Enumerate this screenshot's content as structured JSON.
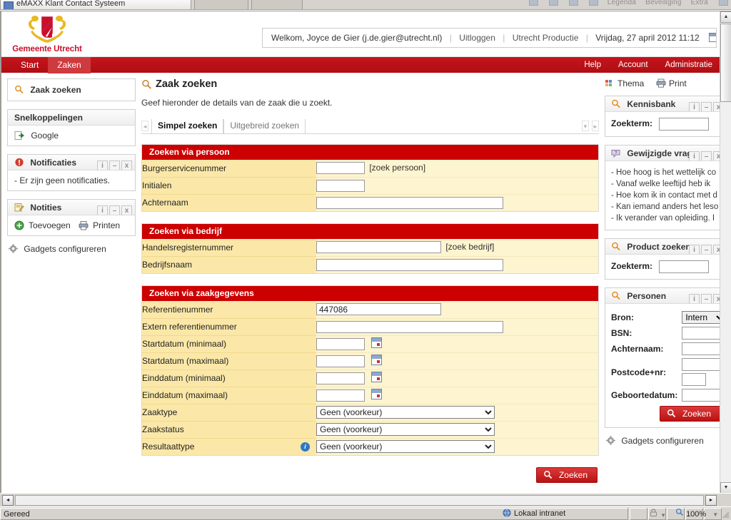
{
  "browser": {
    "tab_title": "eMAXX Klant Contact Systeem",
    "tab_favicon_icon": "page-icon",
    "menu_items": [
      "Legenda",
      "Beveiliging",
      "Extra"
    ],
    "status": {
      "ready_text": "Gereed",
      "zone_text": "Lokaal intranet",
      "zone_icon": "intranet-globe-icon",
      "lock_icon": "lock-icon",
      "zoom_icon": "zoom-icon",
      "zoom_level": "100%",
      "resize_grip_icon": "resize-grip-icon"
    },
    "hscroll": {
      "left_arrow": "◄",
      "right_arrow": "►"
    },
    "vscroll": {
      "up_arrow": "▲",
      "down_arrow": "▼"
    }
  },
  "banner": {
    "logo_icon": "utrecht-coat-of-arms-icon",
    "logo_text": "Gemeente Utrecht",
    "userbar": {
      "welcome": "Welkom, Joyce de Gier (j.de.gier@utrecht.nl)",
      "logout": "Uitloggen",
      "environment": "Utrecht Productie",
      "datetime": "Vrijdag, 27 april 2012 11:12",
      "separator": "|",
      "calendar_icon": "calendar-icon"
    }
  },
  "nav": {
    "tabs": [
      {
        "label": "Start",
        "active": false
      },
      {
        "label": "Zaken",
        "active": true
      }
    ],
    "links": [
      "Help",
      "Account",
      "Administratie"
    ]
  },
  "sidebar_left": {
    "zaak_zoeken": {
      "title": "Zaak zoeken",
      "icon": "magnifier-icon"
    },
    "snelkoppelingen": {
      "title": "Snelkoppelingen",
      "links": [
        {
          "label": "Google",
          "icon": "shortcut-arrow-icon"
        }
      ]
    },
    "notificaties": {
      "title": "Notificaties",
      "icon": "alert-icon",
      "buttons": [
        "i",
        "–",
        "x"
      ],
      "body": "- Er zijn geen notificaties."
    },
    "notities": {
      "title": "Notities",
      "icon": "notepad-icon",
      "buttons": [
        "i",
        "–",
        "x"
      ],
      "actions": [
        {
          "label": "Toevoegen",
          "icon": "plus-circle-icon"
        },
        {
          "label": "Printen",
          "icon": "printer-icon"
        }
      ]
    },
    "gadgets_config": {
      "label": "Gadgets configureren",
      "icon": "gear-icon"
    }
  },
  "main": {
    "title": "Zaak zoeken",
    "title_icon": "magnifier-icon",
    "intro": "Geef hieronder de details van de zaak die u zoekt.",
    "tabs": [
      {
        "label": "Simpel zoeken",
        "active": true
      },
      {
        "label": "Uitgebreid zoeken",
        "active": false
      }
    ],
    "tab_scroll": {
      "left": "◄",
      "down": "▼",
      "right": "►"
    },
    "sections": [
      {
        "title": "Zoeken via persoon",
        "rows": [
          {
            "label": "Burgerservicenummer",
            "type": "text",
            "value": "",
            "width": "sm",
            "hint": "[zoek persoon]"
          },
          {
            "label": "Initialen",
            "type": "text",
            "value": "",
            "width": "sm",
            "hint": ""
          },
          {
            "label": "Achternaam",
            "type": "text",
            "value": "",
            "width": "lg",
            "hint": ""
          }
        ]
      },
      {
        "title": "Zoeken via bedrijf",
        "rows": [
          {
            "label": "Handelsregisternummer",
            "type": "text",
            "value": "",
            "width": "md",
            "hint": "[zoek bedrijf]"
          },
          {
            "label": "Bedrijfsnaam",
            "type": "text",
            "value": "",
            "width": "lg",
            "hint": ""
          }
        ]
      },
      {
        "title": "Zoeken via zaakgegevens",
        "rows": [
          {
            "label": "Referentienummer",
            "type": "text",
            "value": "447086",
            "width": "md",
            "hint": ""
          },
          {
            "label": "Extern referentienummer",
            "type": "text",
            "value": "",
            "width": "lg",
            "hint": ""
          },
          {
            "label": "Startdatum (minimaal)",
            "type": "date",
            "value": "",
            "width": "sm",
            "hint": ""
          },
          {
            "label": "Startdatum (maximaal)",
            "type": "date",
            "value": "",
            "width": "sm",
            "hint": ""
          },
          {
            "label": "Einddatum (minimaal)",
            "type": "date",
            "value": "",
            "width": "sm",
            "hint": ""
          },
          {
            "label": "Einddatum (maximaal)",
            "type": "date",
            "value": "",
            "width": "sm",
            "hint": ""
          },
          {
            "label": "Zaaktype",
            "type": "select",
            "value": "Geen (voorkeur)",
            "hint": ""
          },
          {
            "label": "Zaakstatus",
            "type": "select",
            "value": "Geen (voorkeur)",
            "hint": ""
          },
          {
            "label": "Resultaattype",
            "type": "select",
            "value": "Geen (voorkeur)",
            "hint": "",
            "info": "i"
          }
        ]
      }
    ],
    "search_button": {
      "label": "Zoeken",
      "icon": "magnifier-icon"
    }
  },
  "sidebar_right": {
    "tools": [
      {
        "label": "Thema",
        "icon": "theme-icon"
      },
      {
        "label": "Print",
        "icon": "printer-icon"
      }
    ],
    "kennisbank": {
      "title": "Kennisbank",
      "icon": "magnifier-icon",
      "buttons": [
        "i",
        "–",
        "x"
      ],
      "field_label": "Zoekterm:",
      "field_value": ""
    },
    "gewijzigde_vragen": {
      "title": "Gewijzigde vrag",
      "icon": "question-bubble-icon",
      "buttons": [
        "i",
        "–",
        "x"
      ],
      "items": [
        "- Hoe hoog is het wettelijk co",
        "- Vanaf welke leeftijd heb ik",
        "- Hoe kom ik in contact met d",
        "- Kan iemand anders het leso",
        "- Ik verander van opleiding. I"
      ]
    },
    "product_zoeken": {
      "title": "Product zoeken",
      "icon": "magnifier-icon",
      "buttons": [
        "i",
        "–",
        "x"
      ],
      "field_label": "Zoekterm:",
      "field_value": ""
    },
    "personen": {
      "title": "Personen",
      "icon": "magnifier-icon",
      "buttons": [
        "i",
        "–",
        "x"
      ],
      "fields": [
        {
          "label": "Bron:",
          "type": "select",
          "value": "Intern"
        },
        {
          "label": "BSN:",
          "type": "text",
          "value": ""
        },
        {
          "label": "Achternaam:",
          "type": "text",
          "value": ""
        },
        {
          "label": "Postcode+nr:",
          "type": "text2",
          "value": "",
          "value2": ""
        },
        {
          "label": "Geboortedatum:",
          "type": "text",
          "value": ""
        }
      ],
      "search_button": {
        "label": "Zoeken",
        "icon": "magnifier-icon"
      }
    },
    "gadgets_config": {
      "label": "Gadgets configureren",
      "icon": "gear-icon"
    }
  },
  "colors": {
    "brand_red": "#cc0000",
    "nav_red": "#b00d14",
    "section_label_bg": "#fbe8a8",
    "section_field_bg": "#fdf4d0",
    "logo_red": "#c8102e"
  }
}
